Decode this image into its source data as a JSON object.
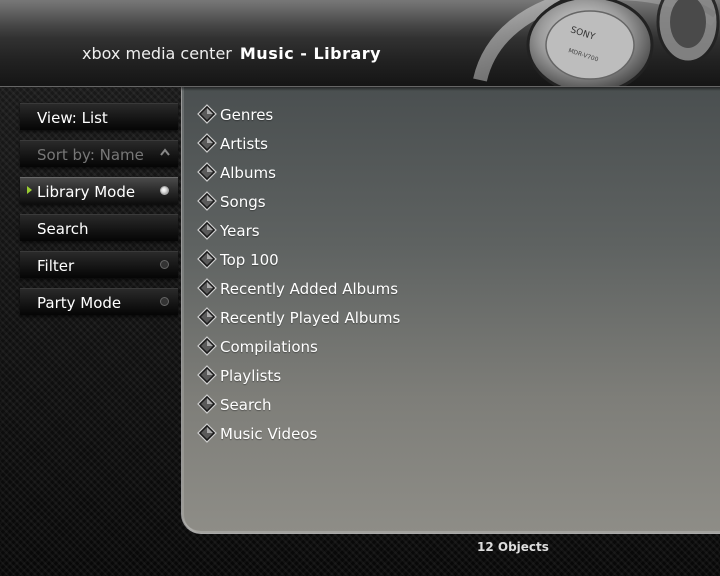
{
  "header": {
    "brand": "xbox media center",
    "section": "Music - Library",
    "headphones_text_1": "SONY",
    "headphones_text_2": "MDR-V700"
  },
  "sidebar": {
    "items": [
      {
        "label": "View: List",
        "state": "normal"
      },
      {
        "label": "Sort by: Name",
        "state": "disabled"
      },
      {
        "label": "Library Mode",
        "state": "focused",
        "toggle": "on"
      },
      {
        "label": "Search",
        "state": "normal"
      },
      {
        "label": "Filter",
        "state": "normal",
        "toggle": "off"
      },
      {
        "label": "Party Mode",
        "state": "normal",
        "toggle": "off"
      }
    ]
  },
  "library": {
    "items": [
      "Genres",
      "Artists",
      "Albums",
      "Songs",
      "Years",
      "Top 100",
      "Recently Added Albums",
      "Recently Played Albums",
      "Compilations",
      "Playlists",
      "Search",
      "Music Videos"
    ]
  },
  "status": {
    "count_label": "12 Objects"
  },
  "colors": {
    "focus_arrow": "#9acd32",
    "panel_top": "#4a4f50",
    "panel_bottom": "#8e8d87"
  },
  "icons": {
    "list_item": "folder-diamond-icon",
    "sort_direction": "chevron-up-icon"
  }
}
